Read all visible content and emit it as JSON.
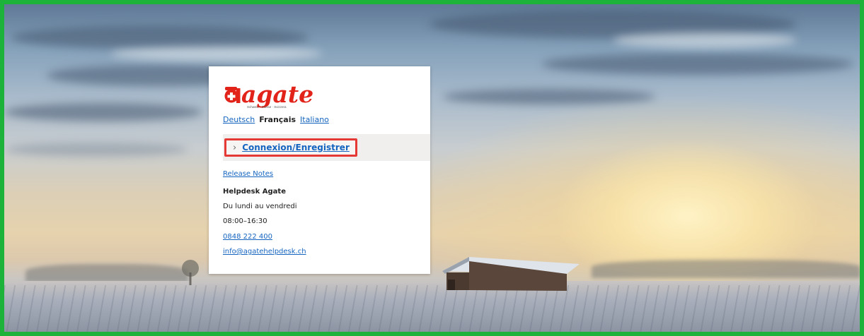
{
  "logo": {
    "wordmark": "agate",
    "tagline": "Schweiz · Suisse · Svizzera"
  },
  "languages": {
    "de": "Deutsch",
    "fr": "Français",
    "it": "Italiano",
    "selected": "Français"
  },
  "login": {
    "label": "Connexion/Enregistrer",
    "icon": "chevron-right-icon",
    "highlight_color": "#e53935"
  },
  "links": {
    "release_notes": "Release Notes"
  },
  "helpdesk": {
    "title": "Helpdesk Agate",
    "days": "Du lundi au vendredi",
    "hours": "08:00–16:30",
    "phone": "0848 222 400",
    "email": "info@agatehelpdesk.ch"
  },
  "colors": {
    "frame_border": "#1db33a",
    "link": "#1565c0",
    "brand_red": "#e2231a"
  }
}
